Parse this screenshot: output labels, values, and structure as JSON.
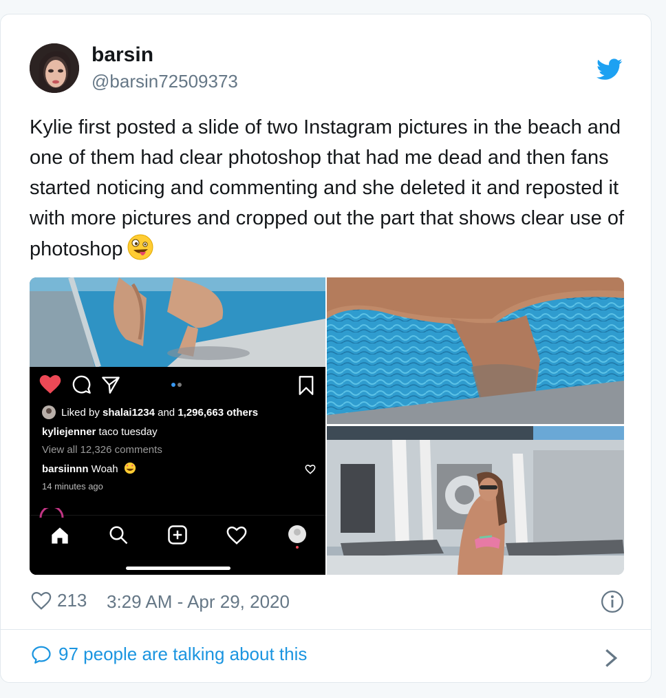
{
  "tweet": {
    "author_name": "barsin",
    "author_handle": "@barsin72509373",
    "text": "Kylie first posted a slide of two Instagram pictures in the beach and one of them had clear photoshop that had me dead and then fans started noticing and commenting and she deleted it and reposted it with more pictures and cropped out the part that shows clear use of photoshop",
    "like_count": "213",
    "timestamp": "3:29 AM - Apr 29, 2020",
    "talking_text": "97 people are talking about this"
  },
  "instagram": {
    "liked_by_prefix": "Liked by ",
    "liked_by_user": "shalai1234",
    "liked_by_mid": " and ",
    "liked_by_others": "1,296,663 others",
    "caption_user": "kyliejenner",
    "caption_text": " taco tuesday",
    "view_comments": "View all 12,326 comments",
    "comment_user": "barsiinnn",
    "comment_text": " Woah",
    "time_ago": "14 minutes ago"
  },
  "colors": {
    "twitter_blue": "#1da1f2",
    "link_blue": "#1b95e0",
    "muted_gray": "#657786",
    "ig_heart_red": "#ed4956",
    "pool_blue": "#2e8fc0"
  },
  "icons": [
    "twitter-bird-icon",
    "like-heart-icon",
    "info-icon",
    "reply-bubble-icon",
    "chevron-right-icon",
    "ig-heart-icon",
    "ig-comment-icon",
    "ig-share-icon",
    "ig-bookmark-icon",
    "ig-home-icon",
    "ig-search-icon",
    "ig-add-icon",
    "ig-activity-icon",
    "ig-profile-icon",
    "zany-face-emoji"
  ]
}
